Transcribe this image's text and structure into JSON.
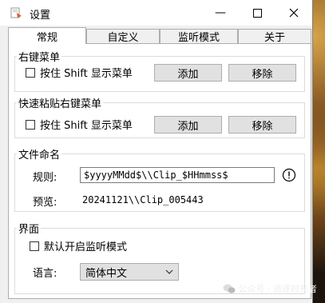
{
  "window": {
    "title": "设置"
  },
  "tabs": [
    {
      "label": "常规"
    },
    {
      "label": "自定义"
    },
    {
      "label": "监听模式"
    },
    {
      "label": "关于"
    }
  ],
  "right_click_menu": {
    "legend": "右键菜单",
    "checkbox_label": "按住 Shift 显示菜单",
    "add_label": "添加",
    "remove_label": "移除"
  },
  "quick_paste_menu": {
    "legend": "快速粘贴右键菜单",
    "checkbox_label": "按住 Shift 显示菜单",
    "add_label": "添加",
    "remove_label": "移除"
  },
  "file_naming": {
    "legend": "文件命名",
    "rule_label": "规则:",
    "rule_value": "$yyyyMMdd$\\\\Clip_$HHmmss$",
    "preview_label": "预览:",
    "preview_value": "20241121\\\\Clip_005443"
  },
  "interface": {
    "legend": "界面",
    "monitor_checkbox_label": "默认开启监听模式",
    "language_label": "语言:",
    "language_value": "简体中文"
  },
  "watermark": {
    "text": "公众号 · 追逐时光者"
  }
}
